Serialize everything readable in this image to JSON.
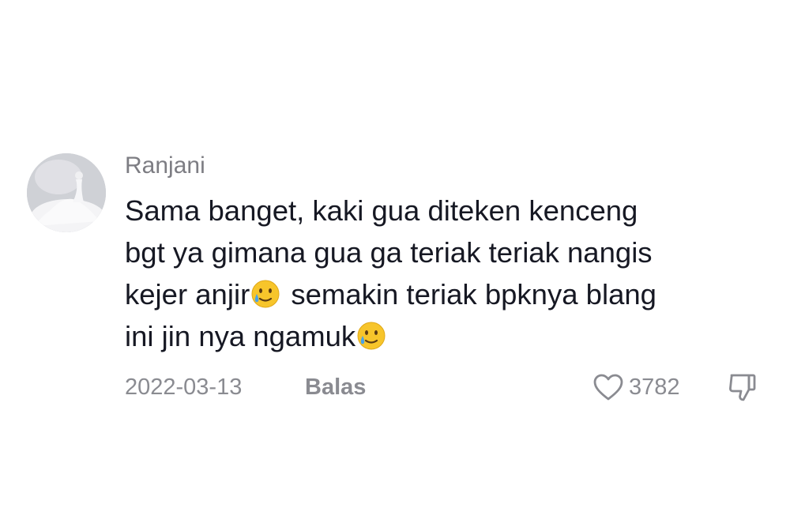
{
  "comment": {
    "username": "Ranjani",
    "text_lines": [
      "Sama banget, kaki gua diteken kenceng",
      "bgt ya gimana gua ga teriak teriak nangis",
      "kejer anjir",
      " semakin teriak bpknya blang",
      "ini jin nya ngamuk"
    ],
    "emoji": "smiling-face-with-tear",
    "date": "2022-03-13",
    "reply_label": "Balas",
    "like_count": "3782",
    "icons": {
      "like": "heart-outline-icon",
      "dislike": "thumbs-down-icon"
    }
  },
  "colors": {
    "username": "#7d7d83",
    "text": "#161823",
    "meta": "#8a8b91",
    "emoji_face": "#f7c52b",
    "emoji_tear": "#4aa3e8"
  }
}
